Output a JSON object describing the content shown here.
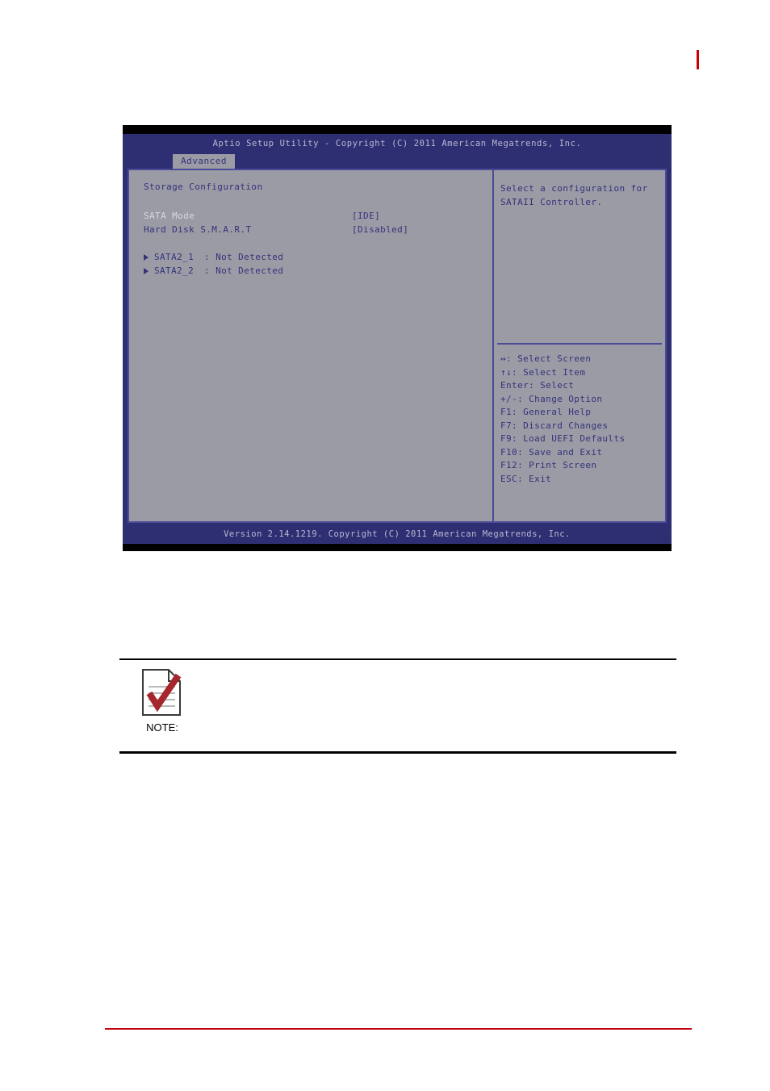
{
  "page": {
    "marker_color": "#cc0000",
    "footer_rule_color": "#c20012"
  },
  "bios": {
    "title": "Aptio Setup Utility - Copyright (C) 2011 American Megatrends, Inc.",
    "tab": "Advanced",
    "section_title": "Storage Configuration",
    "options": [
      {
        "label": "SATA Mode",
        "value": "[IDE]",
        "selected": true
      },
      {
        "label": "Hard Disk S.M.A.R.T",
        "value": "[Disabled]",
        "selected": false
      }
    ],
    "devices": [
      {
        "name": "SATA2_1",
        "separator": ":",
        "status": "Not Detected"
      },
      {
        "name": "SATA2_2",
        "separator": ":",
        "status": "Not Detected"
      }
    ],
    "help": {
      "description": [
        "Select a configuration for",
        "SATAII Controller."
      ],
      "keys": [
        "↔: Select Screen",
        "↑↓: Select Item",
        "Enter: Select",
        "+/-: Change Option",
        "F1: General Help",
        "F7: Discard Changes",
        "F9: Load UEFI Defaults",
        "F10: Save and Exit",
        "F12: Print Screen",
        "ESC: Exit"
      ]
    },
    "footer": "Version 2.14.1219. Copyright (C) 2011 American Megatrends, Inc.",
    "colors": {
      "header_bg": "#2e2e72",
      "panel_bg": "#9b9ba6",
      "border": "#4a4a96",
      "text": "#33337a",
      "selected_text": "#d8d8e2"
    }
  },
  "note": {
    "label": "NOTE:",
    "body": "",
    "icon": "note-check-document-icon"
  }
}
